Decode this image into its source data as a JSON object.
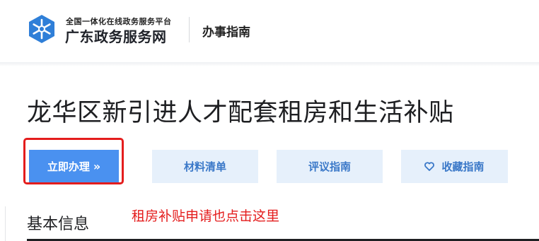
{
  "header": {
    "logo_small": "全国一体化在线政务服务平台",
    "logo_big": "广东政务服务网",
    "nav_title": "办事指南"
  },
  "page": {
    "title": "龙华区新引进人才配套租房和生活补贴"
  },
  "actions": {
    "apply_label": "立即办理",
    "apply_chevron": "»",
    "materials_label": "材料清单",
    "review_label": "评议指南",
    "favorite_label": "收藏指南"
  },
  "section": {
    "title": "基本信息"
  },
  "annotation": {
    "text": "租房补贴申请也点击这里",
    "color": "#e41d1d"
  },
  "colors": {
    "primary": "#4a91f0",
    "secondary_bg": "#e6f0fb",
    "secondary_text": "#3a78c8",
    "logo_blue": "#2f7fd8"
  }
}
